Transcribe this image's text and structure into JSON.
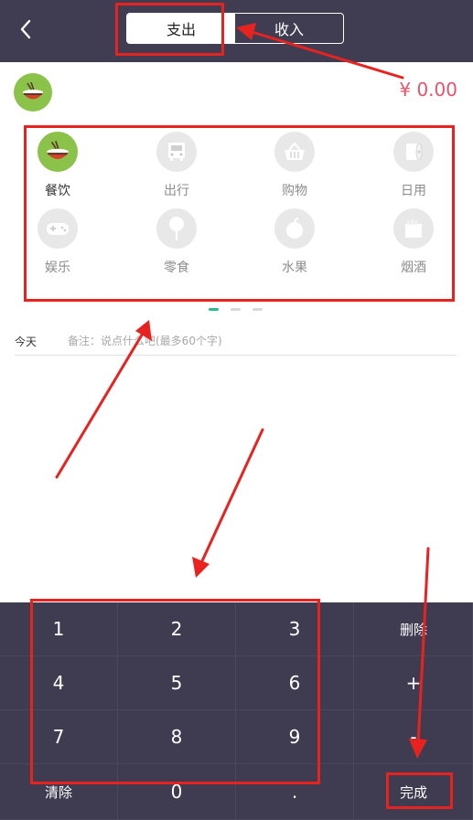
{
  "header": {
    "tabs": [
      {
        "label": "支出",
        "active": true
      },
      {
        "label": "收入",
        "active": false
      }
    ]
  },
  "selected_category": {
    "icon": "rice-bowl-icon"
  },
  "amount": "¥ 0.00",
  "categories": [
    {
      "label": "餐饮",
      "icon": "rice-bowl-icon",
      "active": true
    },
    {
      "label": "出行",
      "icon": "bus-icon",
      "active": false
    },
    {
      "label": "购物",
      "icon": "shopping-basket-icon",
      "active": false
    },
    {
      "label": "日用",
      "icon": "tissue-roll-icon",
      "active": false
    },
    {
      "label": "娱乐",
      "icon": "gamepad-icon",
      "active": false
    },
    {
      "label": "零食",
      "icon": "lollipop-icon",
      "active": false
    },
    {
      "label": "水果",
      "icon": "apple-icon",
      "active": false
    },
    {
      "label": "烟酒",
      "icon": "cigarette-box-icon",
      "active": false
    }
  ],
  "pager": {
    "pages": 3,
    "current": 1
  },
  "memo": {
    "date": "今天",
    "placeholder": "备注：说点什么吧(最多60个字)"
  },
  "keypad": {
    "keys": [
      [
        "1",
        "2",
        "3",
        "删除"
      ],
      [
        "4",
        "5",
        "6",
        "+"
      ],
      [
        "7",
        "8",
        "9",
        "-"
      ],
      [
        "清除",
        "0",
        ".",
        "完成"
      ]
    ]
  },
  "colors": {
    "header_bg": "#403c52",
    "amount": "#e8526a",
    "active_icon_bg": "#8bc34a",
    "keypad_bg": "#3f3b50",
    "pager_active": "#2dbb8b",
    "annotation": "#e8231f"
  }
}
